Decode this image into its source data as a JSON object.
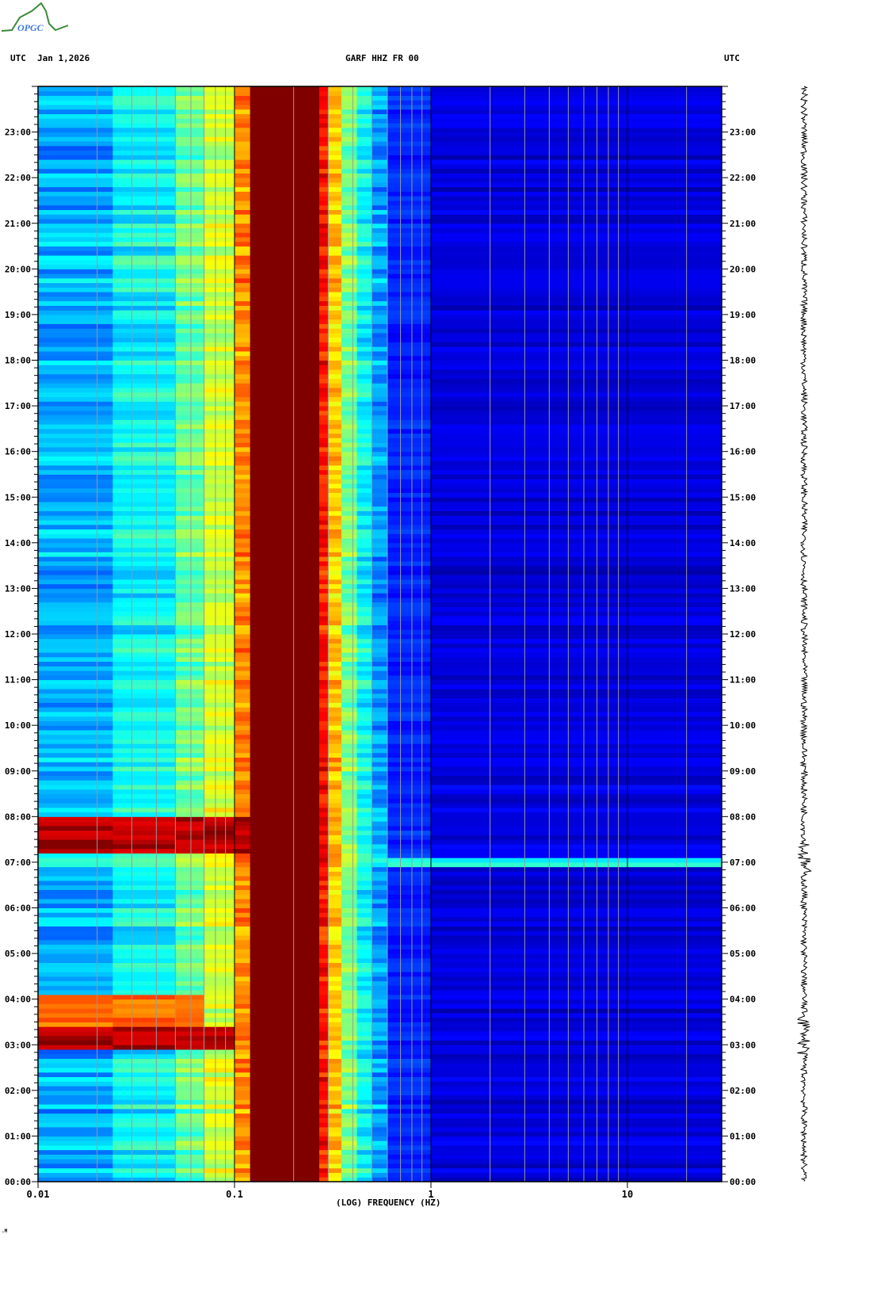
{
  "logo": {
    "text": "OPGC"
  },
  "header": {
    "left_tz": "UTC",
    "date": "Jan 1,2026",
    "station": "GARF HHZ FR 00",
    "right_tz": "UTC"
  },
  "footer": {
    "mark": ".M"
  },
  "chart_data": {
    "type": "heatmap",
    "title": "GARF HHZ FR 00",
    "xlabel": "(LOG) FREQUENCY (HZ)",
    "ylabel": "UTC",
    "xscale": "log",
    "xlim": [
      0.01,
      30
    ],
    "ylim": [
      0,
      24
    ],
    "xticks": [
      {
        "v": 0.01,
        "label": "0.01"
      },
      {
        "v": 0.1,
        "label": "0.1"
      },
      {
        "v": 1,
        "label": "1"
      },
      {
        "v": 10,
        "label": "10"
      }
    ],
    "yticks": [
      "00:00",
      "01:00",
      "02:00",
      "03:00",
      "04:00",
      "05:00",
      "06:00",
      "07:00",
      "08:00",
      "09:00",
      "10:00",
      "11:00",
      "12:00",
      "13:00",
      "14:00",
      "15:00",
      "16:00",
      "17:00",
      "18:00",
      "19:00",
      "20:00",
      "21:00",
      "22:00",
      "23:00"
    ],
    "colormap": "jet",
    "bands": [
      {
        "f0": 0.01,
        "f1": 0.024,
        "level": 0.3
      },
      {
        "f0": 0.024,
        "f1": 0.05,
        "level": 0.38
      },
      {
        "f0": 0.05,
        "f1": 0.07,
        "level": 0.48
      },
      {
        "f0": 0.07,
        "f1": 0.1,
        "level": 0.58
      },
      {
        "f0": 0.1,
        "f1": 0.12,
        "level": 0.74
      },
      {
        "f0": 0.12,
        "f1": 0.27,
        "level": 1.0
      },
      {
        "f0": 0.27,
        "f1": 0.3,
        "level": 0.86
      },
      {
        "f0": 0.3,
        "f1": 0.35,
        "level": 0.68
      },
      {
        "f0": 0.35,
        "f1": 0.42,
        "level": 0.5
      },
      {
        "f0": 0.42,
        "f1": 0.5,
        "level": 0.38
      },
      {
        "f0": 0.5,
        "f1": 0.6,
        "level": 0.28
      },
      {
        "f0": 0.6,
        "f1": 1.0,
        "level": 0.16
      },
      {
        "f0": 1.0,
        "f1": 30,
        "level": 0.09
      }
    ],
    "events": [
      {
        "start": 2.9,
        "end": 3.4,
        "fmax": 0.1,
        "level": 1.0
      },
      {
        "start": 3.4,
        "end": 4.1,
        "fmax": 0.07,
        "level": 0.82
      },
      {
        "start": 7.2,
        "end": 7.9,
        "fmax": 0.12,
        "level": 1.0
      },
      {
        "start": 6.9,
        "end": 7.0,
        "fmax": 2.0,
        "level": 0.45
      }
    ]
  }
}
